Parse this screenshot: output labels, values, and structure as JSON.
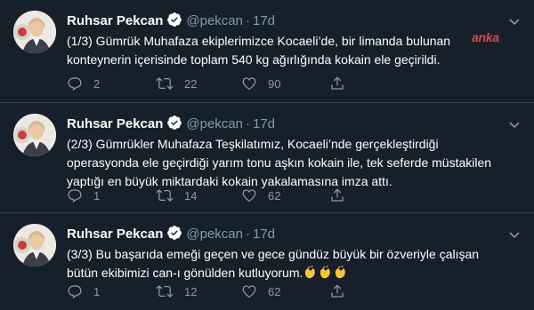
{
  "watermark": "anka",
  "tweets": [
    {
      "name": "Ruhsar Pekcan",
      "handle": "@pekcan",
      "separator": "·",
      "time": "17d",
      "text": "(1/3) Gümrük Muhafaza ekiplerimizce Kocaeli’de, bir limanda bulunan\nkonteynerin içerisinde toplam 540 kg ağırlığında kokain ele geçirildi.",
      "replies": "2",
      "retweets": "22",
      "likes": "90"
    },
    {
      "name": "Ruhsar Pekcan",
      "handle": "@pekcan",
      "separator": "·",
      "time": "17d",
      "text": "(2/3) Gümrükler Muhafaza Teşkilatımız,  Kocaeli’nde gerçekleştirdiği\noperasyonda ele geçirdiği yarım tonu aşkın kokain ile, tek seferde müstakilen\nyaptığı en büyük miktardaki kokain yakalamasına imza attı.",
      "replies": "1",
      "retweets": "14",
      "likes": "62"
    },
    {
      "name": "Ruhsar Pekcan",
      "handle": "@pekcan",
      "separator": "·",
      "time": "17d",
      "text": "(3/3) Bu başarıda emeği geçen ve gece gündüz büyük bir özveriyle çalışan\nbütün ekibimizi can-ı gönülden kutluyorum.",
      "emoji": "clapping-hands x3",
      "replies": "1",
      "retweets": "12",
      "likes": "62"
    }
  ],
  "colors": {
    "background": "#15202b",
    "divider": "#38444d",
    "muted": "#8899a6",
    "verified": "#ffffff"
  }
}
